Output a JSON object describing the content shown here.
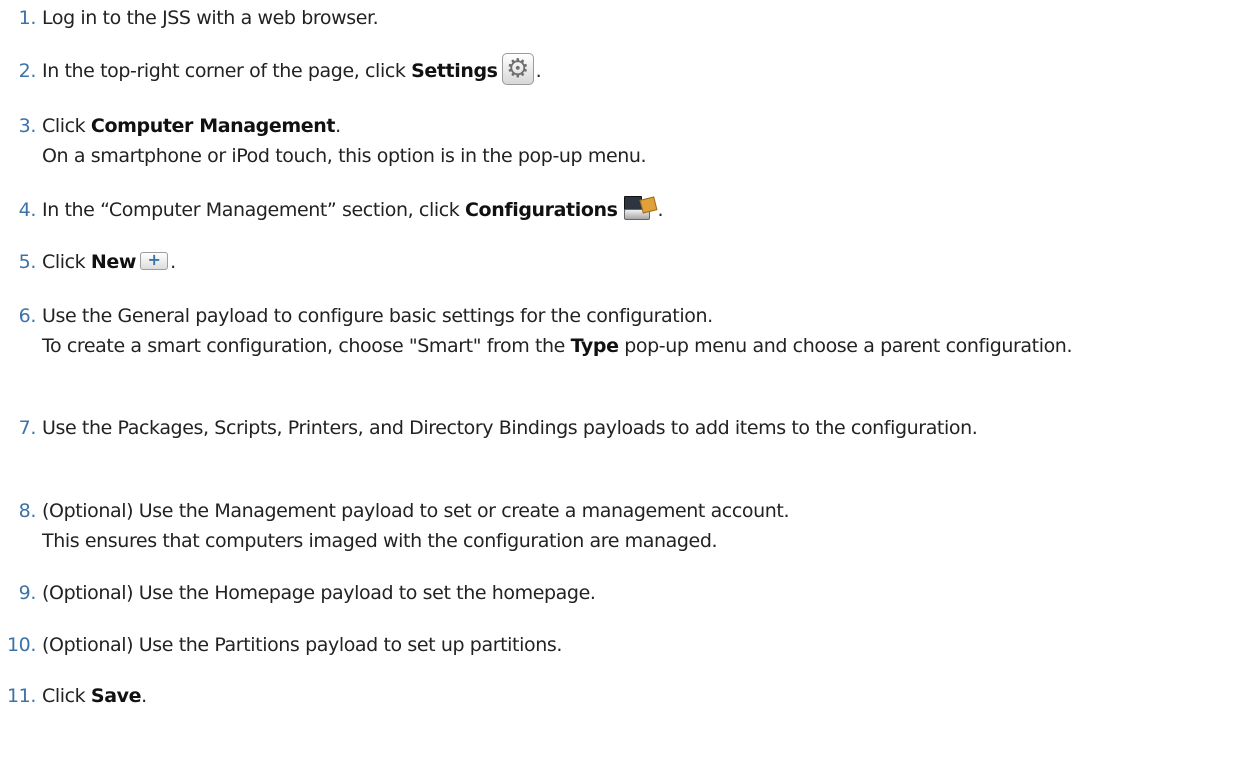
{
  "steps": [
    {
      "number": "1.",
      "text": "Log in to the JSS with a web browser."
    },
    {
      "number": "2.",
      "before": "In the top-right corner of the page, click ",
      "bold": "Settings",
      "icon": "gear-icon",
      "after": "."
    },
    {
      "number": "3.",
      "before": "Click ",
      "bold": "Computer Management",
      "after": ".",
      "note": "On a smartphone or iPod touch, this option is in the pop-up menu."
    },
    {
      "number": "4.",
      "before": "In the “Computer Management” section, click ",
      "bold": "Configurations",
      "icon": "configurations-icon",
      "after": "."
    },
    {
      "number": "5.",
      "before": "Click ",
      "bold": "New",
      "icon": "plus-icon",
      "after": "."
    },
    {
      "number": "6.",
      "text": "Use the General payload to configure basic settings for the configuration.",
      "note_before": "To create a smart configuration, choose \"Smart\" from the ",
      "note_bold": "Type",
      "note_after": " pop-up menu and choose a parent configuration."
    },
    {
      "number": "7.",
      "text": "Use the Packages, Scripts, Printers, and Directory Bindings payloads to add items to the configuration."
    },
    {
      "number": "8.",
      "text": "(Optional) Use the Management payload to set or create a management account.",
      "note": "This ensures that computers imaged with the configuration are managed."
    },
    {
      "number": "9.",
      "text": "(Optional) Use the Homepage payload to set the homepage."
    },
    {
      "number": "10.",
      "text": "(Optional) Use the Partitions payload to set up partitions."
    },
    {
      "number": "11.",
      "before": "Click ",
      "bold": "Save",
      "after": "."
    }
  ],
  "colors": {
    "number": "#3b73a8",
    "text": "#222222"
  }
}
